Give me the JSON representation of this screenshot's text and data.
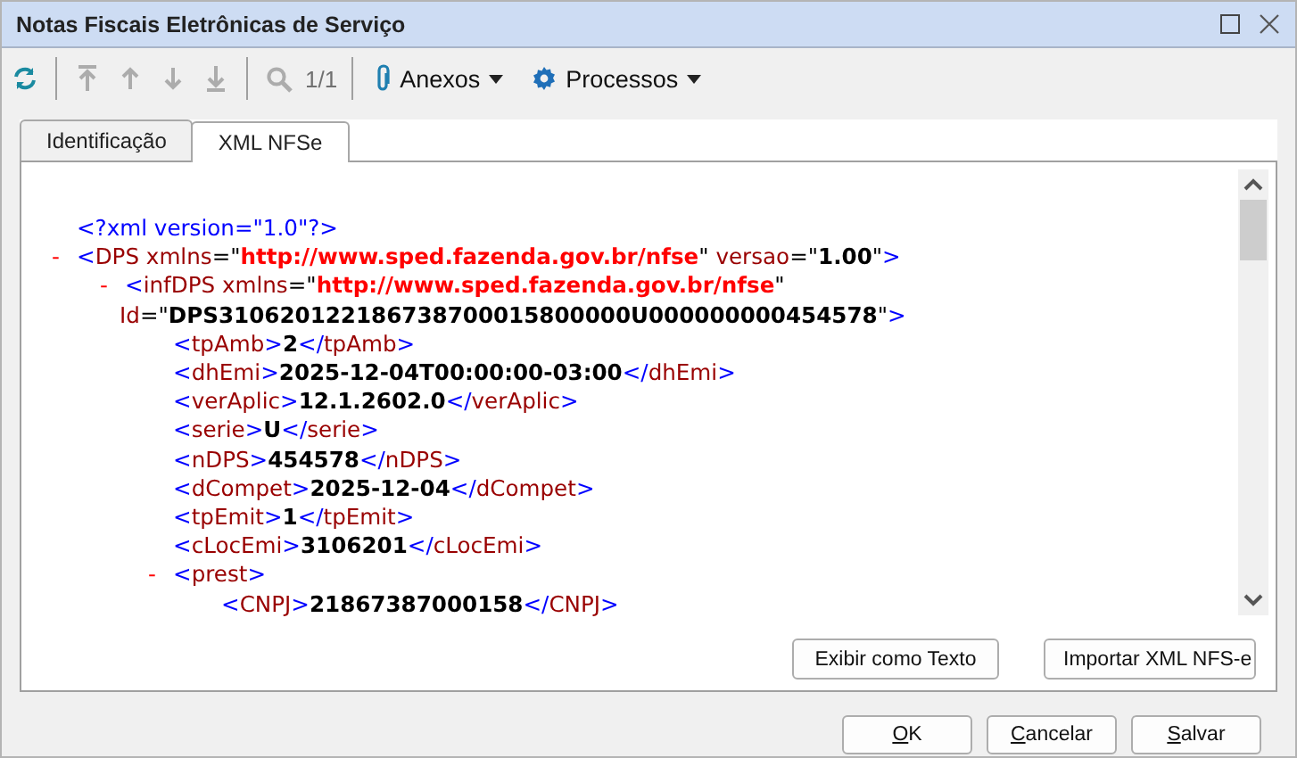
{
  "window": {
    "title": "Notas Fiscais Eletrônicas de Serviço"
  },
  "toolbar": [
    {
      "kind": "refresh",
      "disabled": false
    },
    {
      "kind": "separator"
    },
    {
      "kind": "first",
      "disabled": true
    },
    {
      "kind": "up",
      "disabled": true
    },
    {
      "kind": "down",
      "disabled": true
    },
    {
      "kind": "last",
      "disabled": true
    },
    {
      "kind": "separator"
    },
    {
      "kind": "search",
      "disabled": true
    },
    {
      "kind": "counter",
      "text": "1/1",
      "disabled": true
    },
    {
      "kind": "separator"
    },
    {
      "kind": "attachments-menu",
      "label": "Anexos",
      "disabled": false
    },
    {
      "kind": "settings-menu",
      "label": "Processos",
      "disabled": false
    }
  ],
  "tabs": [
    {
      "label": "Identificação",
      "selected": false
    },
    {
      "label": "XML NFSe",
      "selected": true
    }
  ],
  "xml": [
    {
      "lines": [
        [
          {
            "kind": "punct",
            "text": "<?xml version=\"1.0\"?>"
          }
        ]
      ]
    },
    {
      "toggle": "-",
      "lines": [
        [
          {
            "kind": "punct",
            "text": "<"
          },
          {
            "kind": "name",
            "text": "DPS"
          },
          {
            "kind": "attr",
            "text": " xmlns"
          },
          {
            "kind": "eq",
            "text": "=\""
          },
          {
            "kind": "value",
            "text": "http://www.sped.fazenda.gov.br/nfse"
          },
          {
            "kind": "eq",
            "text": "\""
          },
          {
            "kind": "attr",
            "text": " versao"
          },
          {
            "kind": "eq",
            "text": "=\""
          },
          {
            "kind": "text",
            "text": "1.00"
          },
          {
            "kind": "eq",
            "text": "\""
          },
          {
            "kind": "punct",
            "text": ">"
          }
        ]
      ],
      "children": [
        {
          "toggle": "-",
          "lines": [
            [
              {
                "kind": "punct",
                "text": "<"
              },
              {
                "kind": "name",
                "text": "infDPS"
              },
              {
                "kind": "attr",
                "text": " xmlns"
              },
              {
                "kind": "eq",
                "text": "=\""
              },
              {
                "kind": "value",
                "text": "http://www.sped.fazenda.gov.br/nfse"
              },
              {
                "kind": "eq",
                "text": "\""
              }
            ],
            [
              {
                "kind": "attr",
                "text": "Id"
              },
              {
                "kind": "eq",
                "text": "=\""
              },
              {
                "kind": "text",
                "text": "DPS310620122186738700015800000U000000000454578"
              },
              {
                "kind": "eq",
                "text": "\""
              },
              {
                "kind": "punct",
                "text": ">"
              }
            ]
          ],
          "children": [
            {
              "lines": [
                [
                  {
                    "kind": "punct",
                    "text": "<"
                  },
                  {
                    "kind": "name",
                    "text": "tpAmb"
                  },
                  {
                    "kind": "punct",
                    "text": ">"
                  },
                  {
                    "kind": "text",
                    "text": "2"
                  },
                  {
                    "kind": "punct",
                    "text": "</"
                  },
                  {
                    "kind": "name",
                    "text": "tpAmb"
                  },
                  {
                    "kind": "punct",
                    "text": ">"
                  }
                ]
              ]
            },
            {
              "lines": [
                [
                  {
                    "kind": "punct",
                    "text": "<"
                  },
                  {
                    "kind": "name",
                    "text": "dhEmi"
                  },
                  {
                    "kind": "punct",
                    "text": ">"
                  },
                  {
                    "kind": "text",
                    "text": "2025-12-04T00:00:00-03:00"
                  },
                  {
                    "kind": "punct",
                    "text": "</"
                  },
                  {
                    "kind": "name",
                    "text": "dhEmi"
                  },
                  {
                    "kind": "punct",
                    "text": ">"
                  }
                ]
              ]
            },
            {
              "lines": [
                [
                  {
                    "kind": "punct",
                    "text": "<"
                  },
                  {
                    "kind": "name",
                    "text": "verAplic"
                  },
                  {
                    "kind": "punct",
                    "text": ">"
                  },
                  {
                    "kind": "text",
                    "text": "12.1.2602.0"
                  },
                  {
                    "kind": "punct",
                    "text": "</"
                  },
                  {
                    "kind": "name",
                    "text": "verAplic"
                  },
                  {
                    "kind": "punct",
                    "text": ">"
                  }
                ]
              ]
            },
            {
              "lines": [
                [
                  {
                    "kind": "punct",
                    "text": "<"
                  },
                  {
                    "kind": "name",
                    "text": "serie"
                  },
                  {
                    "kind": "punct",
                    "text": ">"
                  },
                  {
                    "kind": "text",
                    "text": "U"
                  },
                  {
                    "kind": "punct",
                    "text": "</"
                  },
                  {
                    "kind": "name",
                    "text": "serie"
                  },
                  {
                    "kind": "punct",
                    "text": ">"
                  }
                ]
              ]
            },
            {
              "lines": [
                [
                  {
                    "kind": "punct",
                    "text": "<"
                  },
                  {
                    "kind": "name",
                    "text": "nDPS"
                  },
                  {
                    "kind": "punct",
                    "text": ">"
                  },
                  {
                    "kind": "text",
                    "text": "454578"
                  },
                  {
                    "kind": "punct",
                    "text": "</"
                  },
                  {
                    "kind": "name",
                    "text": "nDPS"
                  },
                  {
                    "kind": "punct",
                    "text": ">"
                  }
                ]
              ]
            },
            {
              "lines": [
                [
                  {
                    "kind": "punct",
                    "text": "<"
                  },
                  {
                    "kind": "name",
                    "text": "dCompet"
                  },
                  {
                    "kind": "punct",
                    "text": ">"
                  },
                  {
                    "kind": "text",
                    "text": "2025-12-04"
                  },
                  {
                    "kind": "punct",
                    "text": "</"
                  },
                  {
                    "kind": "name",
                    "text": "dCompet"
                  },
                  {
                    "kind": "punct",
                    "text": ">"
                  }
                ]
              ]
            },
            {
              "lines": [
                [
                  {
                    "kind": "punct",
                    "text": "<"
                  },
                  {
                    "kind": "name",
                    "text": "tpEmit"
                  },
                  {
                    "kind": "punct",
                    "text": ">"
                  },
                  {
                    "kind": "text",
                    "text": "1"
                  },
                  {
                    "kind": "punct",
                    "text": "</"
                  },
                  {
                    "kind": "name",
                    "text": "tpEmit"
                  },
                  {
                    "kind": "punct",
                    "text": ">"
                  }
                ]
              ]
            },
            {
              "lines": [
                [
                  {
                    "kind": "punct",
                    "text": "<"
                  },
                  {
                    "kind": "name",
                    "text": "cLocEmi"
                  },
                  {
                    "kind": "punct",
                    "text": ">"
                  },
                  {
                    "kind": "text",
                    "text": "3106201"
                  },
                  {
                    "kind": "punct",
                    "text": "</"
                  },
                  {
                    "kind": "name",
                    "text": "cLocEmi"
                  },
                  {
                    "kind": "punct",
                    "text": ">"
                  }
                ]
              ]
            },
            {
              "toggle": "-",
              "lines": [
                [
                  {
                    "kind": "punct",
                    "text": "<"
                  },
                  {
                    "kind": "name",
                    "text": "prest"
                  },
                  {
                    "kind": "punct",
                    "text": ">"
                  }
                ]
              ],
              "children": [
                {
                  "lines": [
                    [
                      {
                        "kind": "punct",
                        "text": "<"
                      },
                      {
                        "kind": "name",
                        "text": "CNPJ"
                      },
                      {
                        "kind": "punct",
                        "text": ">"
                      },
                      {
                        "kind": "text",
                        "text": "21867387000158"
                      },
                      {
                        "kind": "punct",
                        "text": "</"
                      },
                      {
                        "kind": "name",
                        "text": "CNPJ"
                      },
                      {
                        "kind": "punct",
                        "text": ">"
                      }
                    ]
                  ]
                }
              ]
            }
          ]
        }
      ]
    }
  ],
  "panel_buttons": [
    {
      "label": "Exibir como Texto"
    },
    {
      "label": "Importar XML NFS-e"
    }
  ],
  "dialog_buttons": [
    {
      "label_key": "O",
      "label_rest": "K"
    },
    {
      "label_key": "C",
      "label_rest": "ancelar"
    },
    {
      "label_key": "S",
      "label_rest": "alvar"
    }
  ]
}
